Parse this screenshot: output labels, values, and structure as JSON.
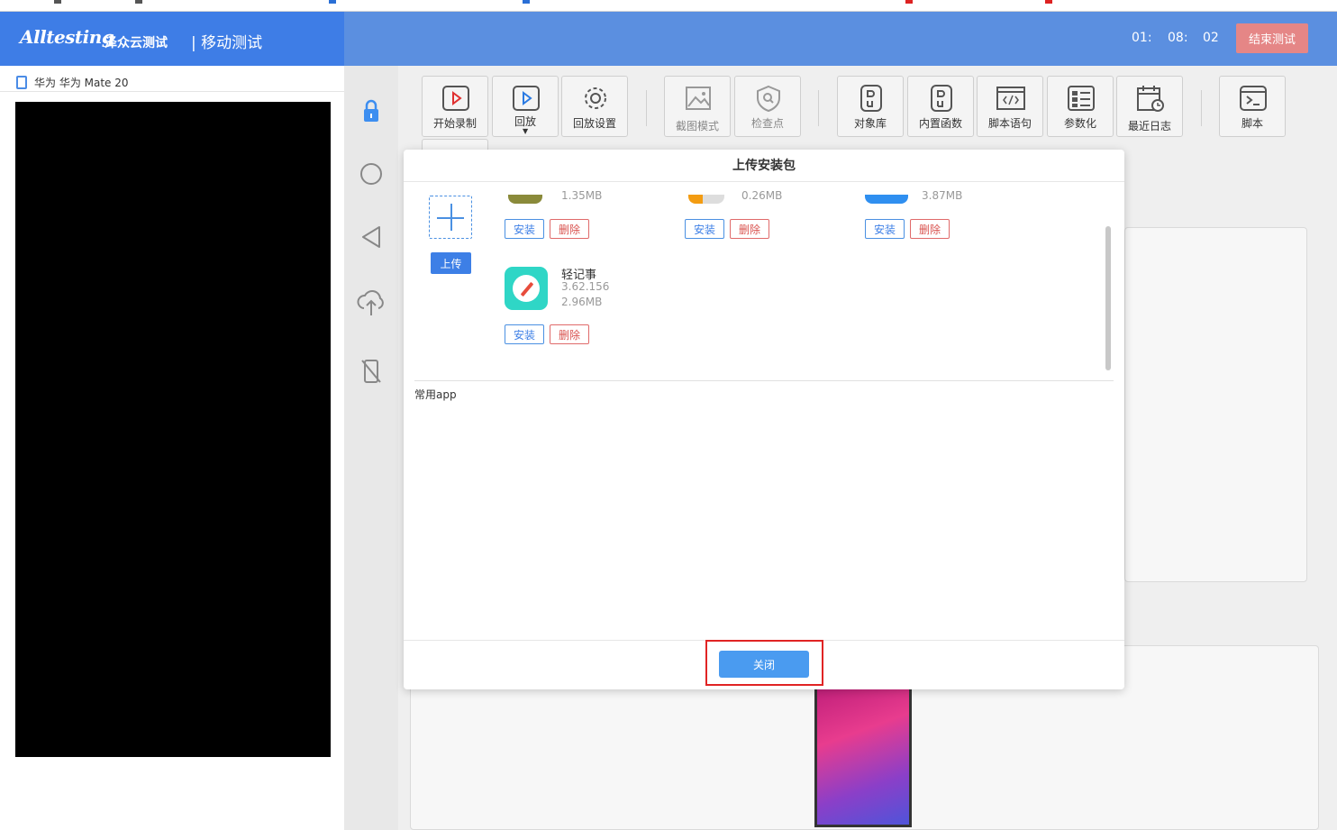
{
  "header": {
    "logo_text": "Alltesting",
    "logo_cn": "泽众云测试",
    "module_title": "| 移动测试",
    "timer": [
      "01:",
      "08:",
      "02"
    ],
    "end_button": "结束测试"
  },
  "device": {
    "label": "华为 华为 Mate 20"
  },
  "side_tools": [
    "lock-icon",
    "home-circle-icon",
    "back-triangle-icon",
    "cloud-upload-icon",
    "rotate-device-icon"
  ],
  "toolbar": {
    "items": [
      {
        "label": "开始录制",
        "icon": "record-icon",
        "disabled": false
      },
      {
        "label": "回放",
        "icon": "playback-icon",
        "disabled": false
      },
      {
        "label": "回放设置",
        "icon": "gear-icon",
        "disabled": false
      },
      {
        "label": "截图模式",
        "icon": "screenshot-icon",
        "disabled": true
      },
      {
        "label": "检查点",
        "icon": "checkpoint-icon",
        "disabled": true
      },
      {
        "label": "对象库",
        "icon": "object-library-icon",
        "disabled": false
      },
      {
        "label": "内置函数",
        "icon": "builtin-function-icon",
        "disabled": false
      },
      {
        "label": "脚本语句",
        "icon": "code-icon",
        "disabled": false
      },
      {
        "label": "参数化",
        "icon": "parameterize-icon",
        "disabled": false
      },
      {
        "label": "最近日志",
        "icon": "log-icon",
        "disabled": false
      },
      {
        "label": "脚本",
        "icon": "terminal-icon",
        "disabled": false
      }
    ]
  },
  "modal": {
    "title": "上传安装包",
    "upload_button": "上传",
    "install_label": "安装",
    "delete_label": "删除",
    "packages_partial": [
      {
        "size": "1.35MB"
      },
      {
        "size": "0.26MB"
      },
      {
        "size": "3.87MB"
      }
    ],
    "package": {
      "name": "轻记事",
      "version": "3.62.156",
      "size": "2.96MB"
    },
    "section_label": "常用app",
    "close_button": "关闭"
  },
  "colors": {
    "header_blue": "#5b8fe0",
    "brand_blue": "#3e7de6",
    "end_button": "#e58686",
    "close_button": "#4a9bf0",
    "highlight_red": "#e02424"
  }
}
